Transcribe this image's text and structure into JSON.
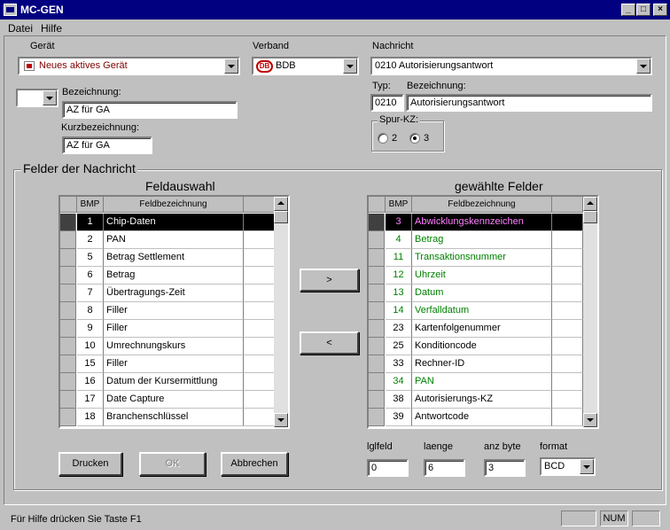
{
  "window": {
    "title": "MC-GEN"
  },
  "menu": {
    "datei": "Datei",
    "hilfe": "Hilfe"
  },
  "geraet": {
    "label": "Gerät",
    "value": "Neues aktives Gerät"
  },
  "verband": {
    "label": "Verband",
    "value": "BDB",
    "logo": "DB"
  },
  "nachricht": {
    "label": "Nachricht",
    "value": "0210 Autorisierungsantwort"
  },
  "typ": {
    "label": "Typ:",
    "value": "0210"
  },
  "bezeichnung_right": {
    "label": "Bezeichnung:",
    "value": "Autorisierungsantwort"
  },
  "bezeichnung_left": {
    "label": "Bezeichnung:",
    "value": "AZ für GA"
  },
  "kurzbezeichnung": {
    "label": "Kurzbezeichnung:",
    "value": "AZ für GA"
  },
  "spur": {
    "label": "Spur-KZ:",
    "options": [
      "2",
      "3"
    ],
    "selected": "3"
  },
  "felder_group": {
    "label": "Felder der Nachricht"
  },
  "feldauswahl": {
    "title": "Feldauswahl",
    "headers": [
      "BMP",
      "Feldbezeichnung"
    ],
    "rows": [
      {
        "bmp": "1",
        "name": "Chip-Daten"
      },
      {
        "bmp": "2",
        "name": "PAN"
      },
      {
        "bmp": "5",
        "name": "Betrag Settlement"
      },
      {
        "bmp": "6",
        "name": "Betrag"
      },
      {
        "bmp": "7",
        "name": "Übertragungs-Zeit"
      },
      {
        "bmp": "8",
        "name": "Filler"
      },
      {
        "bmp": "9",
        "name": "Filler"
      },
      {
        "bmp": "10",
        "name": "Umrechnungskurs"
      },
      {
        "bmp": "15",
        "name": "Filler"
      },
      {
        "bmp": "16",
        "name": "Datum der Kursermittlung"
      },
      {
        "bmp": "17",
        "name": "Date Capture"
      },
      {
        "bmp": "18",
        "name": "Branchenschlüssel"
      }
    ]
  },
  "gewaehlte": {
    "title": "gewählte Felder",
    "headers": [
      "BMP",
      "Feldbezeichnung"
    ],
    "rows": [
      {
        "bmp": "3",
        "name": "Abwicklungskennzeichen"
      },
      {
        "bmp": "4",
        "name": "Betrag"
      },
      {
        "bmp": "11",
        "name": "Transaktionsnummer"
      },
      {
        "bmp": "12",
        "name": "Uhrzeit"
      },
      {
        "bmp": "13",
        "name": "Datum"
      },
      {
        "bmp": "14",
        "name": "Verfalldatum"
      },
      {
        "bmp": "23",
        "name": "Kartenfolgenummer"
      },
      {
        "bmp": "25",
        "name": "Konditioncode"
      },
      {
        "bmp": "33",
        "name": "Rechner-ID"
      },
      {
        "bmp": "34",
        "name": "PAN"
      },
      {
        "bmp": "38",
        "name": "Autorisierungs-KZ"
      },
      {
        "bmp": "39",
        "name": "Antwortcode"
      }
    ]
  },
  "buttons": {
    "add": ">",
    "remove": "<",
    "drucken": "Drucken",
    "ok": "OK",
    "abbrechen": "Abbrechen"
  },
  "fields": {
    "lglfeld": {
      "label": "lglfeld",
      "value": "0"
    },
    "laenge": {
      "label": "laenge",
      "value": "6"
    },
    "anz_byte": {
      "label": "anz byte",
      "value": "3"
    },
    "format": {
      "label": "format",
      "value": "BCD"
    }
  },
  "status": {
    "text": "Für Hilfe drücken Sie Taste F1",
    "num": "NUM"
  },
  "colors": {
    "title_bg": "#000080",
    "selected_row_text": "#ff80ff",
    "green_row_text": "#008000",
    "geraet_text": "#800000"
  }
}
